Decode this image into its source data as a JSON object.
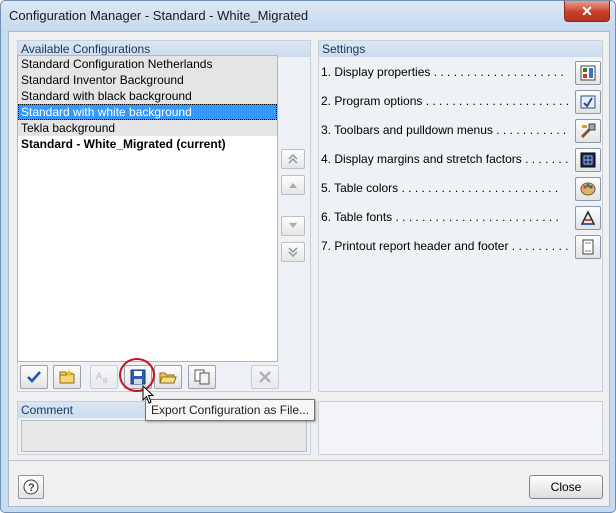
{
  "window": {
    "title": "Configuration Manager - Standard - White_Migrated",
    "close_glyph": "✕"
  },
  "configurations": {
    "header": "Available Configurations",
    "items": [
      {
        "label": "Standard Configuration Netherlands"
      },
      {
        "label": "Standard Inventor Background"
      },
      {
        "label": "Standard with black background"
      },
      {
        "label": "Standard with white background"
      },
      {
        "label": "Tekla background"
      },
      {
        "label": "Standard - White_Migrated (current)"
      }
    ],
    "selected_index": 3
  },
  "settings": {
    "header": "Settings",
    "items": [
      {
        "label": "1. Display properties . . . . . . . . . . . . . . . . . . . .",
        "icon": "display-properties-icon"
      },
      {
        "label": "2. Program options . . . . . . . . . . . . . . . . . . . . . .",
        "icon": "program-options-icon"
      },
      {
        "label": "3. Toolbars and pulldown menus . . . . . . . . . . . . . . .",
        "icon": "toolbars-icon"
      },
      {
        "label": "4. Display margins and stretch factors . . . . . . . . . . .",
        "icon": "margins-icon"
      },
      {
        "label": "5. Table colors . . . . . . . . . . . . . . . . . . . . . . . .",
        "icon": "table-colors-icon"
      },
      {
        "label": "6. Table fonts . . . . . . . . . . . . . . . . . . . . . . . . .",
        "icon": "table-fonts-icon"
      },
      {
        "label": "7. Printout report header and footer . . . . . . . . . . . .",
        "icon": "printout-icon"
      }
    ]
  },
  "comment": {
    "header": "Comment",
    "value": ""
  },
  "tooltip": {
    "text": "Export Configuration as File..."
  },
  "footer": {
    "close_label": "Close",
    "help_glyph": "?"
  }
}
